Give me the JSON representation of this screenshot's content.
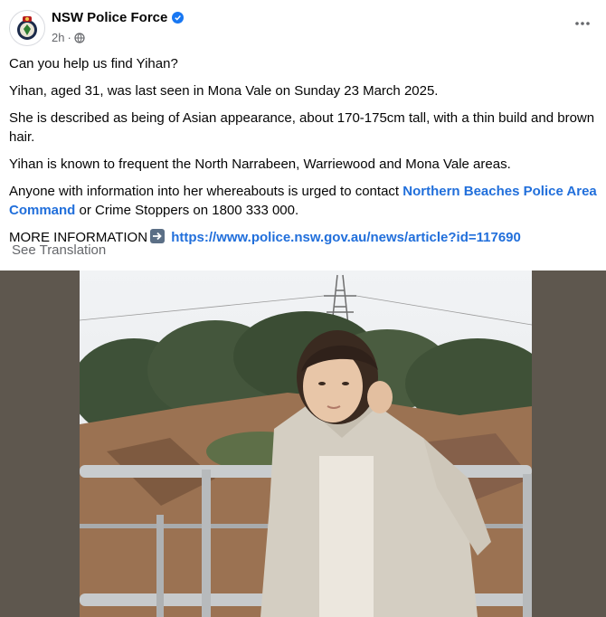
{
  "post": {
    "page_name": "NSW Police Force",
    "time": "2h",
    "time_separator": "·",
    "paragraphs": {
      "p1": "Can you help us find Yihan?",
      "p2": "Yihan, aged 31, was last seen in Mona Vale on Sunday 23 March 2025.",
      "p3": "She is described as being of Asian appearance, about 170-175cm tall, with a thin build and brown hair.",
      "p4": "Yihan is known to frequent the North Narrabeen, Warriewood and Mona Vale areas.",
      "p5_before": "Anyone with information into her whereabouts is urged to contact ",
      "p5_link": "Northern Beaches Police Area Command",
      "p5_after": " or Crime Stoppers on 1800 333 000.",
      "p6_label": "MORE INFORMATION",
      "p6_link": "https://www.police.nsw.gov.au/news/article?id=117690"
    },
    "see_translation": "See Translation"
  },
  "icons": {
    "avatar": "nsw-police-badge-icon",
    "verified": "verified-badge-icon",
    "audience": "globe-icon",
    "more": "more-options-icon",
    "arrow": "right-arrow-emoji-icon"
  },
  "colors": {
    "link": "#216fdb",
    "verified": "#1877f2",
    "muted_text": "#65676b",
    "photo_backdrop": "#5e574e"
  }
}
